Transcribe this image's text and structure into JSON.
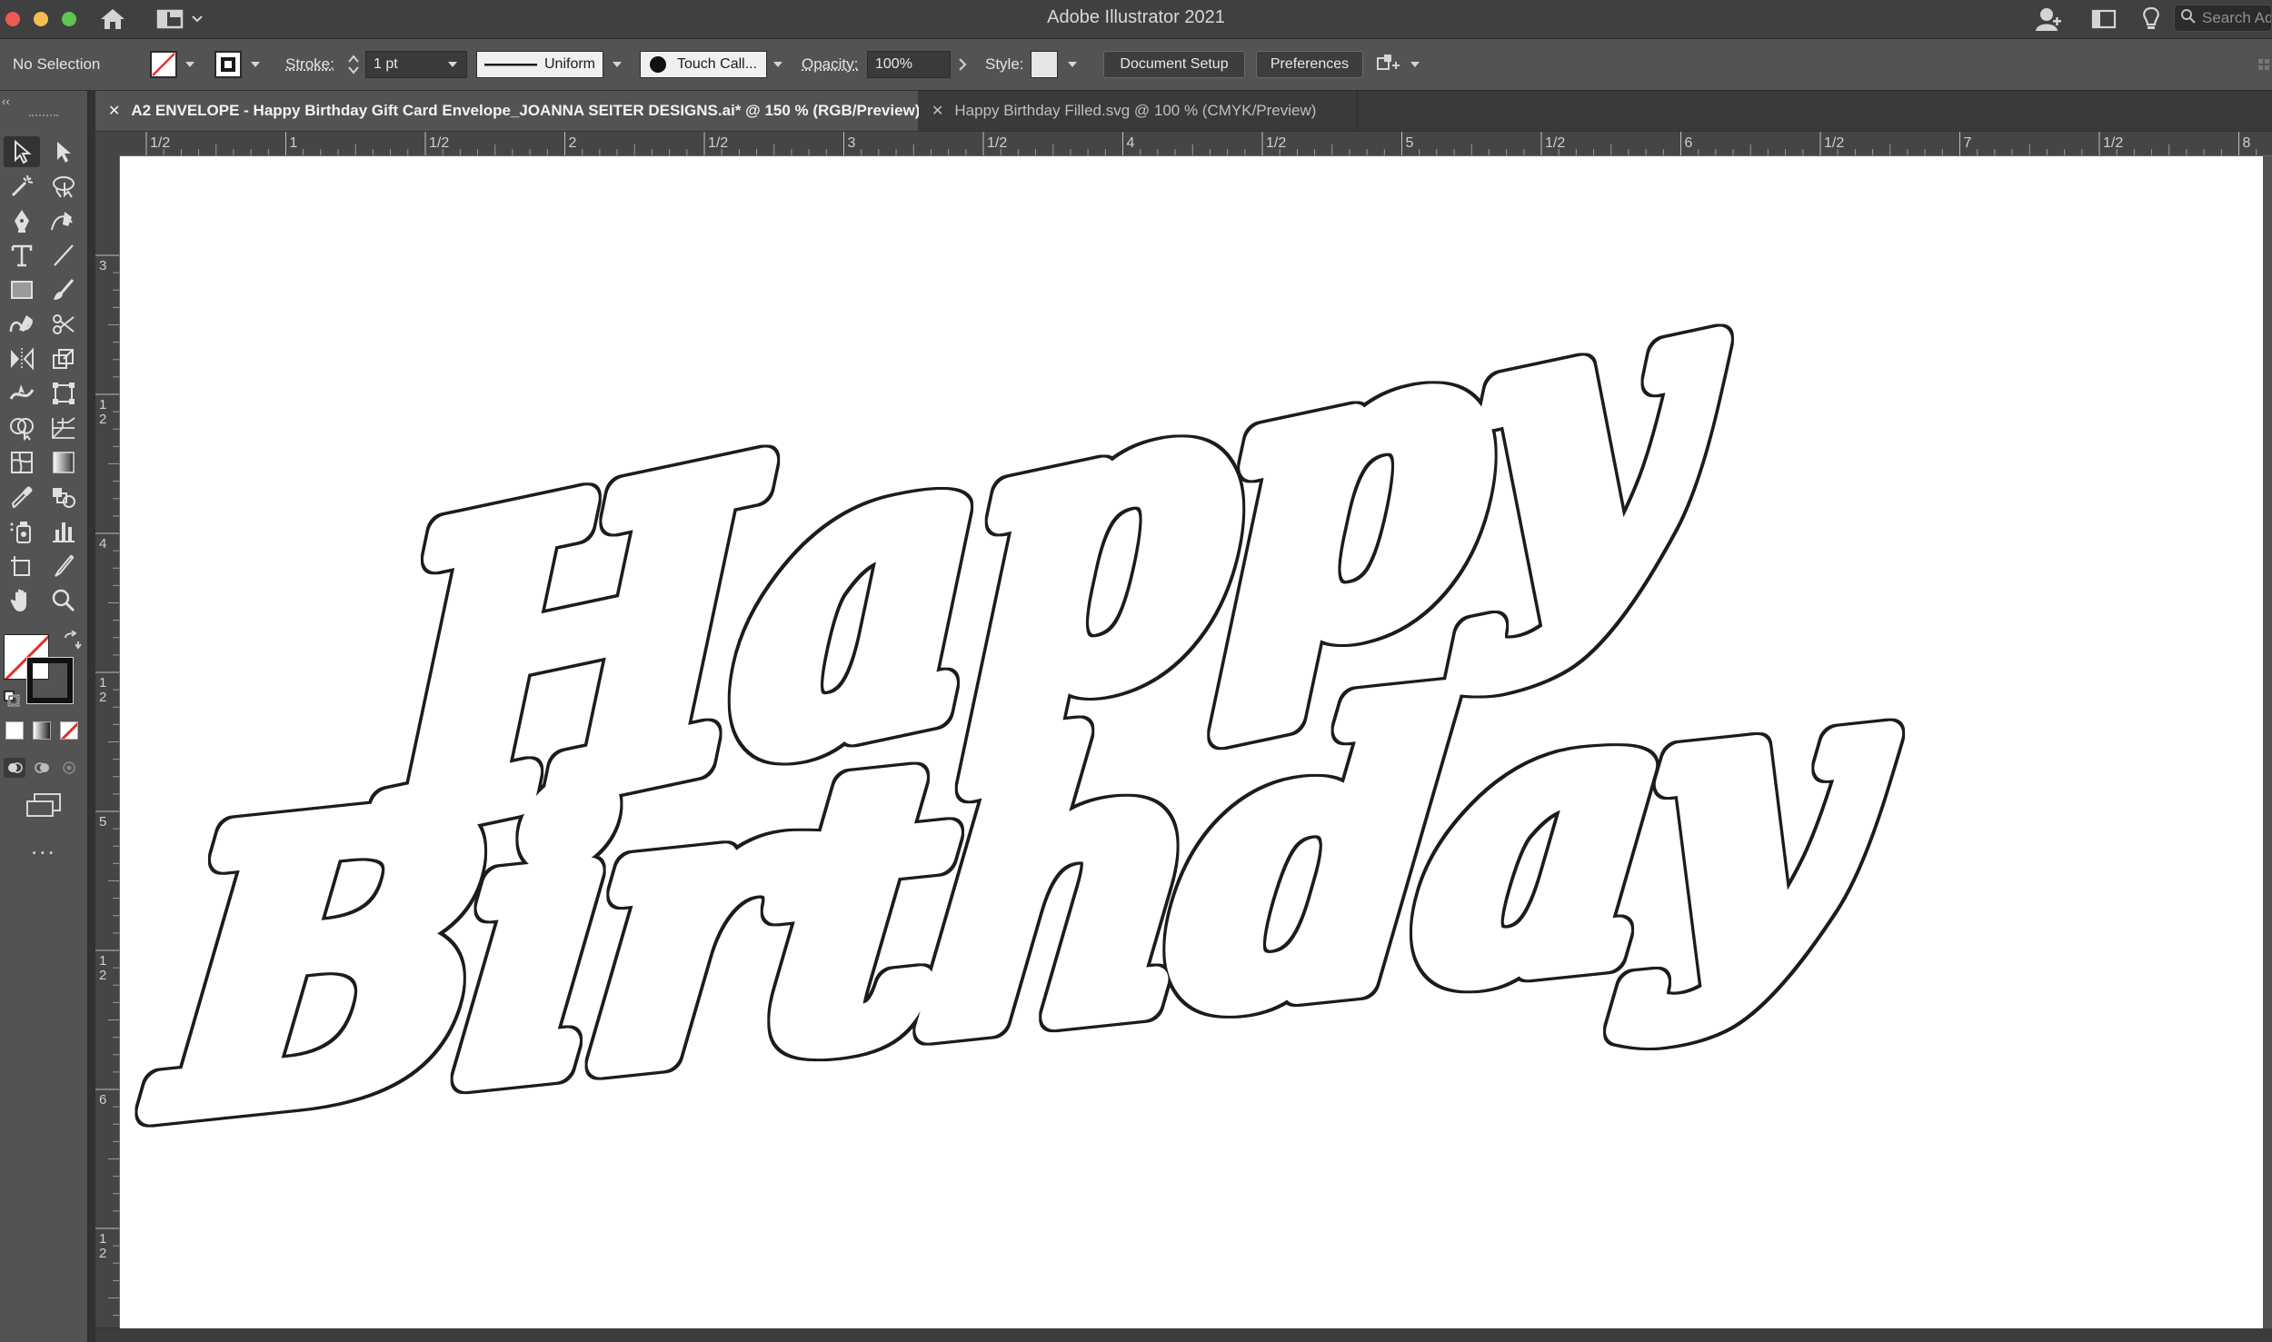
{
  "app": {
    "title": "Adobe Illustrator 2021",
    "search_placeholder": "Search Adobe Stock"
  },
  "control_bar": {
    "selection_status": "No Selection",
    "stroke_label": "Stroke:",
    "stroke_weight": "1 pt",
    "stroke_profile": "Uniform",
    "brush_name": "Touch Call...",
    "opacity_label": "Opacity:",
    "opacity_value": "100%",
    "style_label": "Style:",
    "document_setup_label": "Document Setup",
    "preferences_label": "Preferences"
  },
  "tabs": [
    {
      "label": "A2 ENVELOPE - Happy Birthday Gift Card Envelope_JOANNA SEITER DESIGNS.ai* @ 150 % (RGB/Preview)",
      "active": true
    },
    {
      "label": "Happy Birthday Filled.svg @ 100 % (CMYK/Preview)",
      "active": false
    }
  ],
  "rulers": {
    "horizontal_labels": [
      "1/2",
      "1",
      "1/2",
      "2",
      "1/2",
      "3",
      "1/2",
      "4",
      "1/2",
      "5",
      "1/2",
      "6",
      "1/2",
      "7",
      "1/2",
      "8"
    ],
    "vertical_labels": [
      "3",
      "1/2",
      "4",
      "1/2",
      "5",
      "1/2",
      "6",
      "1/2"
    ]
  },
  "toolbar": {
    "more_tools_label": "...",
    "tools": [
      "selection-tool-icon",
      "direct-selection-tool-icon",
      "magic-wand-tool-icon",
      "lasso-tool-icon",
      "pen-tool-icon",
      "curvature-tool-icon",
      "type-tool-icon",
      "line-segment-tool-icon",
      "rectangle-tool-icon",
      "paintbrush-tool-icon",
      "shaper-tool-icon",
      "scissors-tool-icon",
      "rotate-tool-icon",
      "scale-tool-icon",
      "width-tool-icon",
      "free-transform-tool-icon",
      "shape-builder-tool-icon",
      "perspective-grid-tool-icon",
      "mesh-tool-icon",
      "gradient-tool-icon",
      "eyedropper-tool-icon",
      "blend-tool-icon",
      "symbol-sprayer-tool-icon",
      "column-graph-tool-icon",
      "artboard-tool-icon",
      "slice-tool-icon",
      "hand-tool-icon",
      "zoom-tool-icon"
    ]
  },
  "artwork": {
    "line1": "Happy",
    "line2": "Birthday",
    "stroke_color": "#1a1a1a"
  },
  "colors": {
    "window_bg": "#323232",
    "panel_bg": "#535353",
    "artboard": "#ffffff",
    "close": "#ee5a52",
    "minimize": "#f5bd4f",
    "zoom": "#5fc454"
  }
}
